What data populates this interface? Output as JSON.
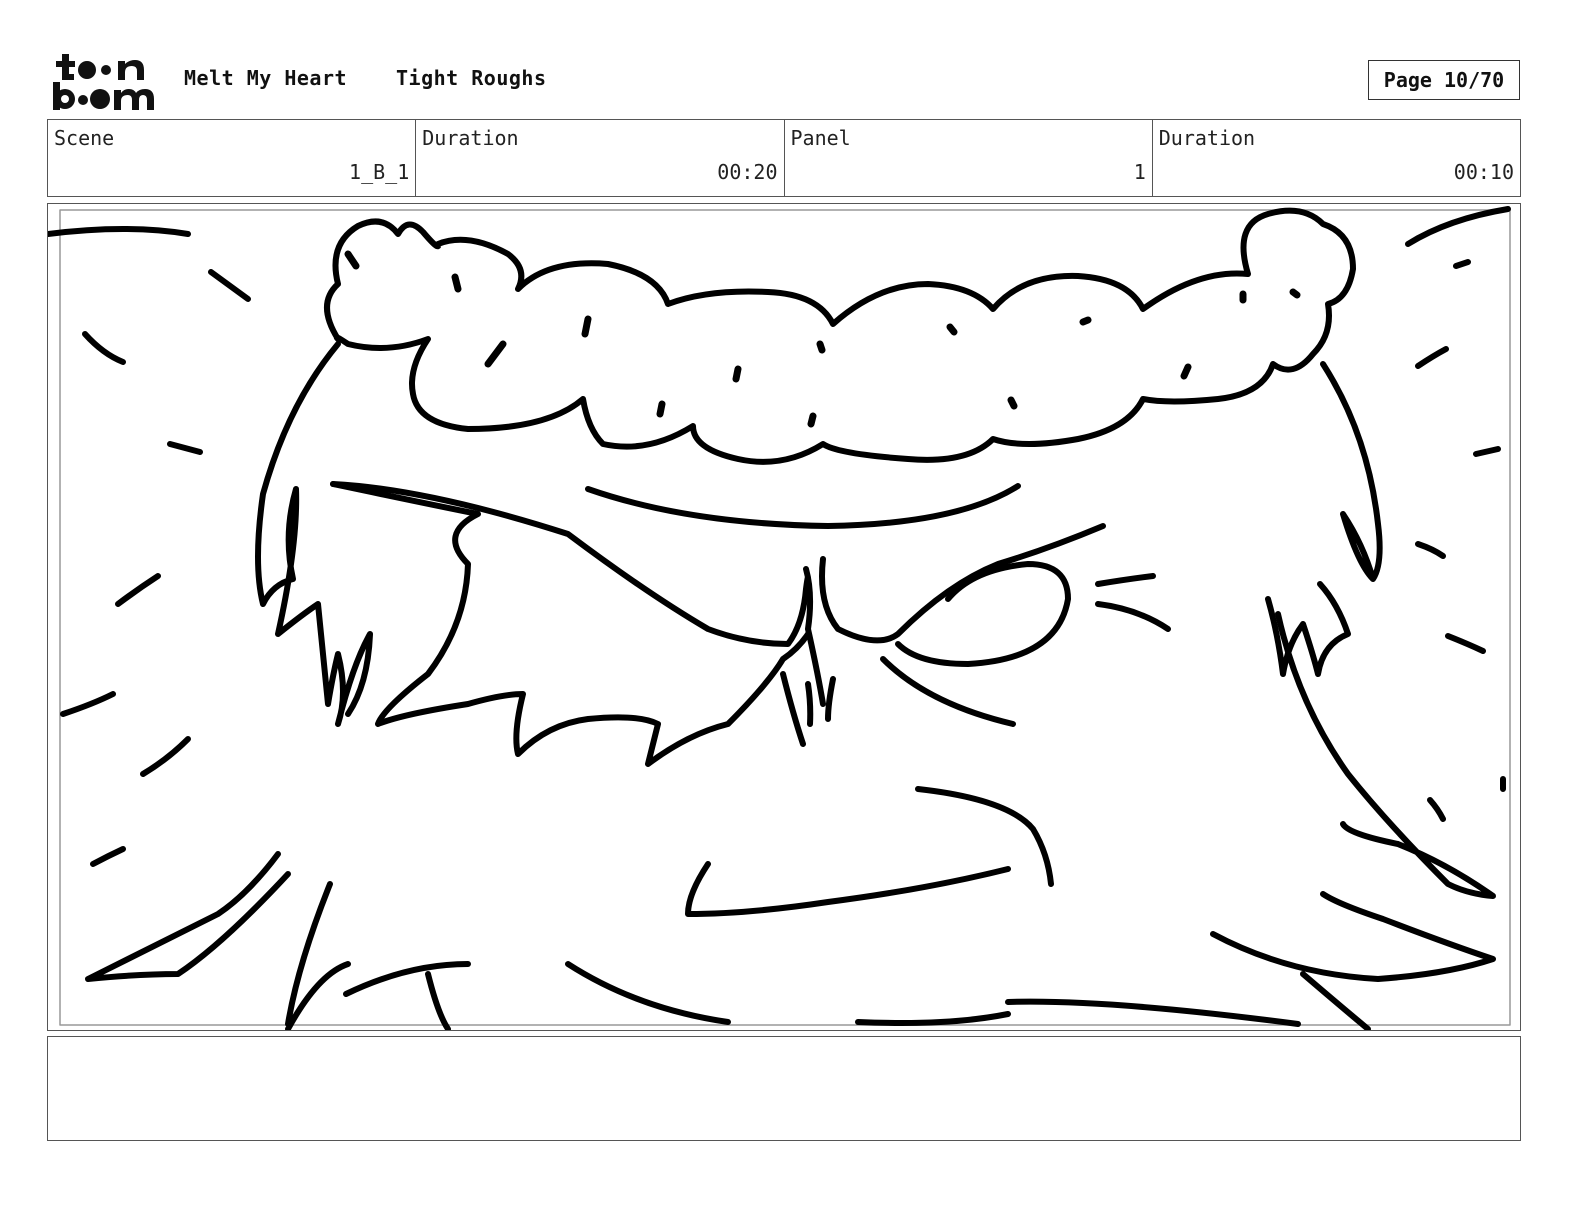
{
  "header": {
    "logo_name": "toon boom",
    "project_title": "Melt My Heart",
    "stage_title": "Tight Roughs",
    "page_label": "Page 10/70"
  },
  "info": {
    "scene_label": "Scene",
    "scene_value": "1_B_1",
    "scene_duration_label": "Duration",
    "scene_duration_value": "00:20",
    "panel_label": "Panel",
    "panel_value": "1",
    "panel_duration_label": "Duration",
    "panel_duration_value": "00:10"
  },
  "notes": {
    "text": ""
  },
  "icons": {
    "logo": "toon-boom-logo-icon"
  }
}
